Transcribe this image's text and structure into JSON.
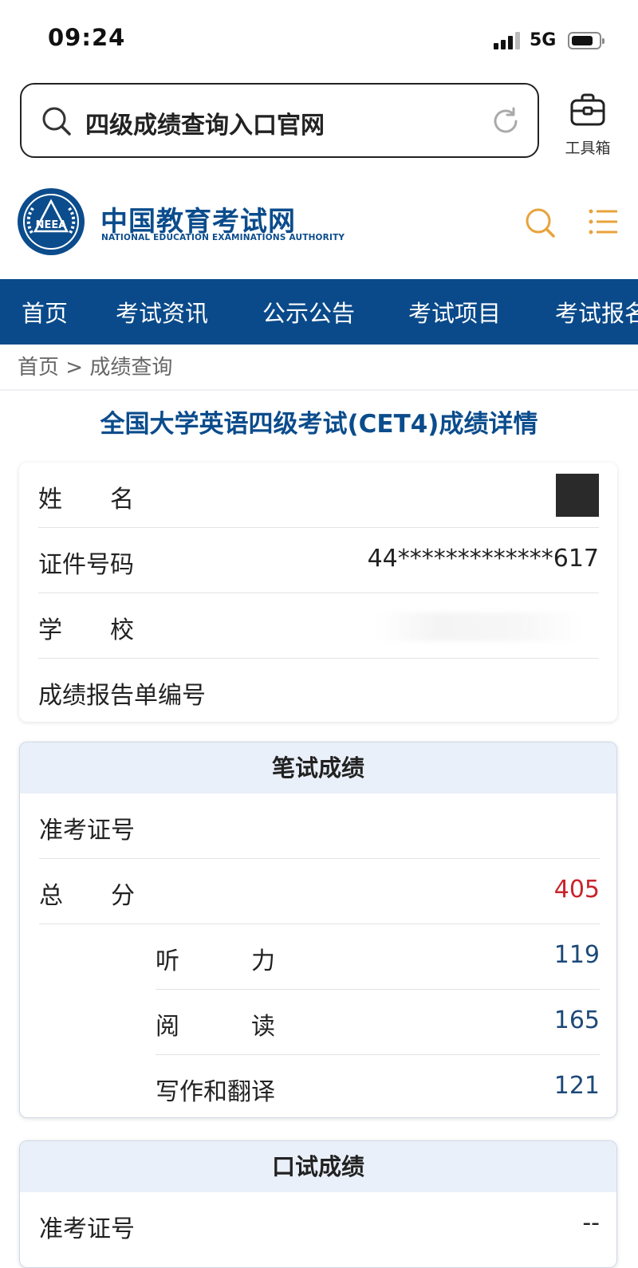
{
  "status_bar": {
    "time": "09:24",
    "network": "5G"
  },
  "browser": {
    "query": "四级成绩查询入口官网",
    "toolbox_label": "工具箱"
  },
  "site": {
    "name": "中国教育考试网",
    "subtitle": "NATIONAL EDUCATION EXAMINATIONS AUTHORITY",
    "logo_text": "NEEA"
  },
  "nav": {
    "items": [
      "首页",
      "考试资讯",
      "公示公告",
      "考试项目",
      "考试报名"
    ]
  },
  "breadcrumb": {
    "home": "首页",
    "separator": ">",
    "current": "成绩查询"
  },
  "page_title": "全国大学英语四级考试(CET4)成绩详情",
  "personal": {
    "name_label": "姓　　名",
    "id_label": "证件号码",
    "id_value": "44*************617",
    "school_label": "学　　校",
    "report_label": "成绩报告单编号"
  },
  "written": {
    "header": "笔试成绩",
    "ticket_label": "准考证号",
    "total_label": "总　　分",
    "total_value": "405",
    "listening_label": "听　　　力",
    "listening_value": "119",
    "reading_label": "阅　　　读",
    "reading_value": "165",
    "writing_label": "写作和翻译",
    "writing_value": "121"
  },
  "oral": {
    "header": "口试成绩",
    "ticket_label": "准考证号",
    "ticket_value": "--"
  },
  "colors": {
    "brand_blue": "#0a4a8a",
    "score_red": "#c9242b",
    "score_blue": "#1d4a78",
    "icon_orange": "#e8a33c"
  }
}
